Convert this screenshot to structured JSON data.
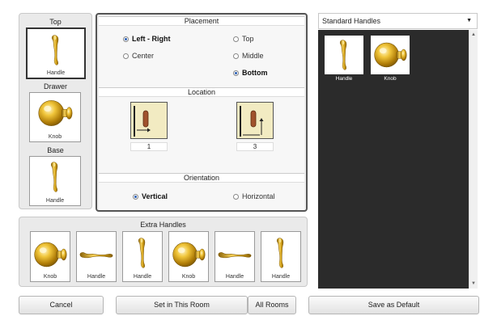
{
  "left_column": {
    "top_label": "Top",
    "top_tile_caption": "Handle",
    "drawer_label": "Drawer",
    "drawer_tile_caption": "Knob",
    "base_label": "Base",
    "base_tile_caption": "Handle"
  },
  "placement": {
    "title": "Placement",
    "options": [
      {
        "label": "Left - Right",
        "selected": true
      },
      {
        "label": "Top",
        "selected": false
      },
      {
        "label": "Center",
        "selected": false
      },
      {
        "label": "Middle",
        "selected": false
      },
      {
        "label": "Bottom",
        "selected": true
      }
    ]
  },
  "location": {
    "title": "Location",
    "value_1": "1",
    "value_2": "3"
  },
  "orientation": {
    "title": "Orientation",
    "vertical_label": "Vertical",
    "horizontal_label": "Horizontal",
    "selected": "Vertical"
  },
  "extra_handles": {
    "title": "Extra Handles",
    "items": [
      {
        "caption": "Knob"
      },
      {
        "caption": "Handle"
      },
      {
        "caption": "Handle"
      },
      {
        "caption": "Knob"
      },
      {
        "caption": "Handle"
      },
      {
        "caption": "Handle"
      }
    ]
  },
  "library": {
    "dropdown_value": "Standard Handles",
    "items": [
      {
        "caption": "Handle"
      },
      {
        "caption": "Knob"
      }
    ]
  },
  "buttons": {
    "cancel": "Cancel",
    "set_in_room": "Set in This Room",
    "all_rooms": "All Rooms",
    "save_default": "Save as Default"
  },
  "colors": {
    "brass": "#d9a514",
    "selected_radio": "#2b5fb5",
    "library_bg": "#2b2b2b",
    "location_tile": "#f2ebc2"
  }
}
